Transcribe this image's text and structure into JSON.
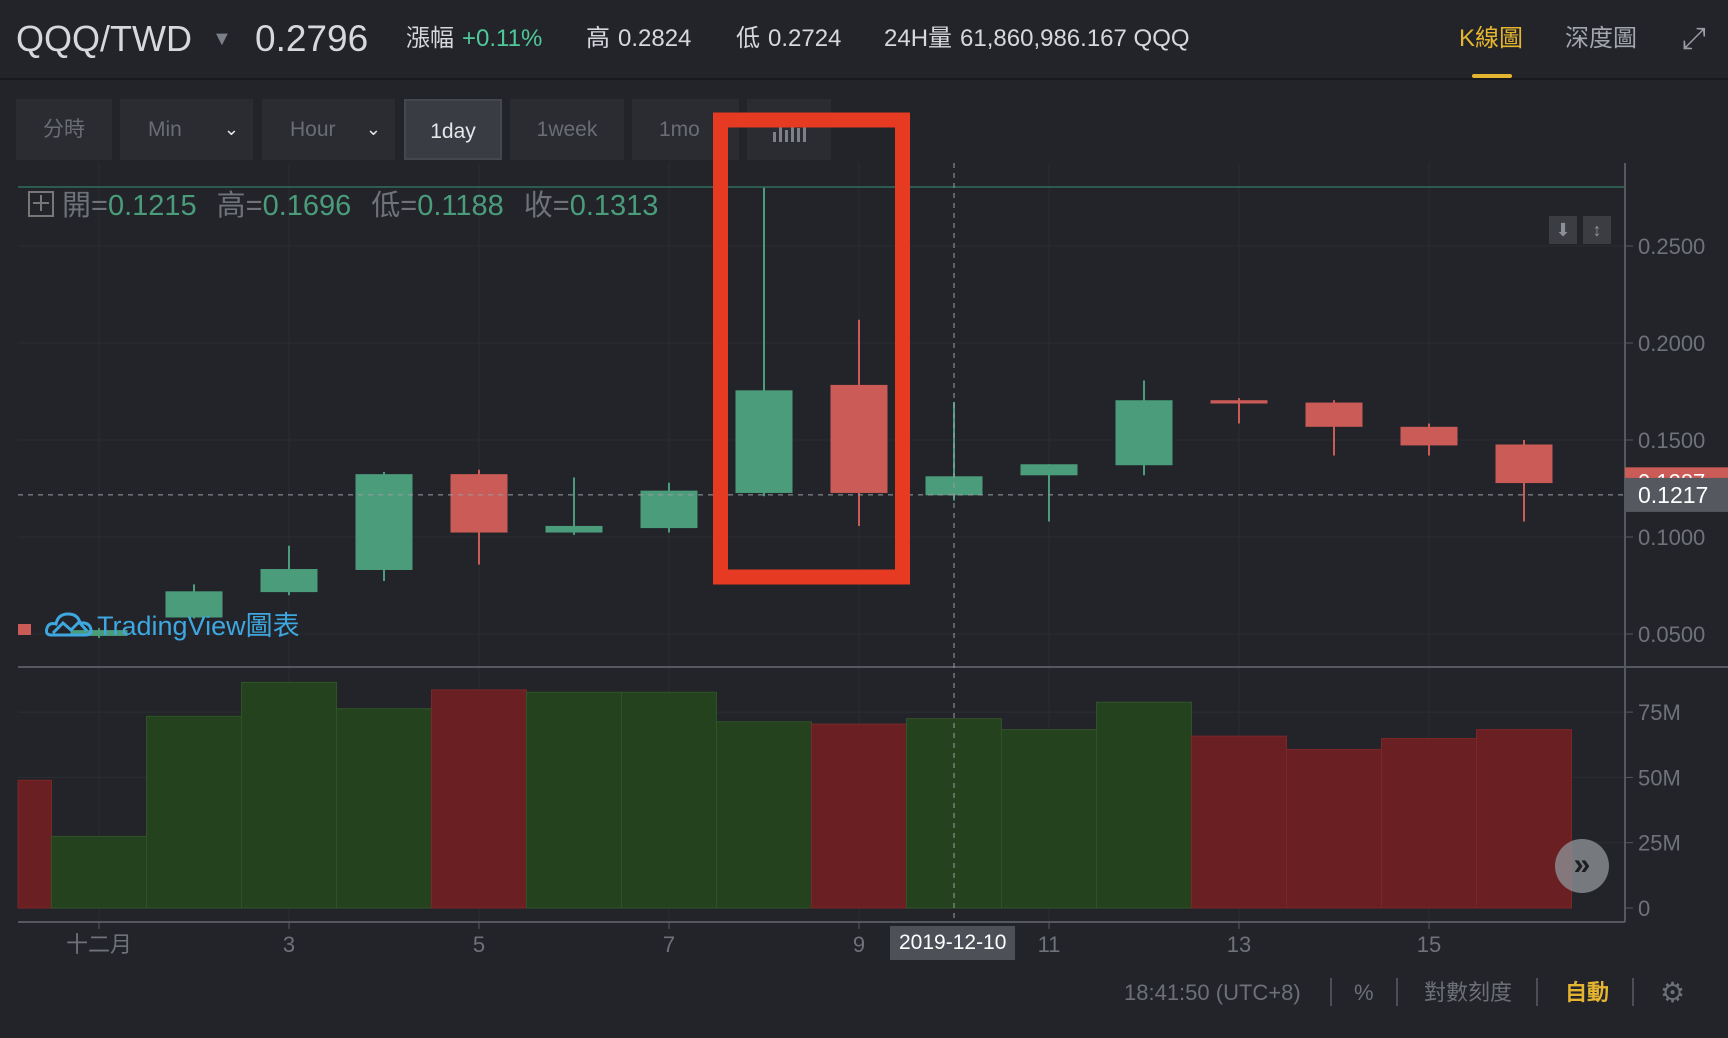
{
  "header": {
    "pair": "QQQ/TWD",
    "price": "0.2796",
    "change_label": "漲幅",
    "change_value": "+0.11%",
    "high_label": "高",
    "high_value": "0.2824",
    "low_label": "低",
    "low_value": "0.2724",
    "volume_label": "24H量",
    "volume_value": "61,860,986.167 QQQ",
    "tabs": [
      {
        "label": "K線圖",
        "active": true
      },
      {
        "label": "深度圖",
        "active": false
      }
    ]
  },
  "toolbar": {
    "items": [
      {
        "label": "分時"
      },
      {
        "label": "Min",
        "dropdown": true
      },
      {
        "label": "Hour",
        "dropdown": true
      },
      {
        "label": "1day",
        "active": true
      },
      {
        "label": "1week"
      },
      {
        "label": "1mo"
      }
    ]
  },
  "legend": {
    "open_label": "開=",
    "open": "0.1215",
    "high_label": "高=",
    "high": "0.1696",
    "low_label": "低=",
    "low": "0.1188",
    "close_label": "收=",
    "close": "0.1313"
  },
  "watermark": "TradingView圖表",
  "colors": {
    "up": "#4a9c7b",
    "down": "#cb5b56",
    "vol_up": "#25421f",
    "vol_down": "#6a1f22",
    "accent": "#e5b431",
    "highlight": "#e63a22"
  },
  "chart_data": {
    "type": "candlestick",
    "x_ticks": [
      "十二月",
      "3",
      "5",
      "7",
      "9",
      "11",
      "13",
      "15"
    ],
    "price_ticks": [
      "0.2500",
      "0.2000",
      "0.1500",
      "0.1000",
      "0.0500"
    ],
    "volume_ticks": [
      "75M",
      "50M",
      "25M",
      "0"
    ],
    "price_range": [
      0.03,
      0.29
    ],
    "crosshair_date": "2019-12-10",
    "crosshair_price": "0.1217",
    "last_price": "0.1287",
    "highlighted_days": [
      8,
      9
    ],
    "candles": [
      {
        "day": 1,
        "o": 0.049,
        "h": 0.053,
        "l": 0.048,
        "c": 0.052
      },
      {
        "day": 2,
        "o": 0.0585,
        "h": 0.0756,
        "l": 0.058,
        "c": 0.072
      },
      {
        "day": 3,
        "o": 0.0716,
        "h": 0.0955,
        "l": 0.07,
        "c": 0.0835
      },
      {
        "day": 4,
        "o": 0.083,
        "h": 0.1335,
        "l": 0.0773,
        "c": 0.1324
      },
      {
        "day": 5,
        "o": 0.1324,
        "h": 0.1347,
        "l": 0.0858,
        "c": 0.1023
      },
      {
        "day": 6,
        "o": 0.1023,
        "h": 0.1307,
        "l": 0.1011,
        "c": 0.1057
      },
      {
        "day": 7,
        "o": 0.1046,
        "h": 0.128,
        "l": 0.1023,
        "c": 0.1239
      },
      {
        "day": 8,
        "o": 0.1227,
        "h": 0.28,
        "l": 0.121,
        "c": 0.1756
      },
      {
        "day": 9,
        "o": 0.1784,
        "h": 0.212,
        "l": 0.1057,
        "c": 0.1227
      },
      {
        "day": 10,
        "o": 0.1215,
        "h": 0.1696,
        "l": 0.1188,
        "c": 0.1313
      },
      {
        "day": 11,
        "o": 0.1318,
        "h": 0.1375,
        "l": 0.108,
        "c": 0.1375
      },
      {
        "day": 12,
        "o": 0.137,
        "h": 0.1807,
        "l": 0.1318,
        "c": 0.1705
      },
      {
        "day": 13,
        "o": 0.1705,
        "h": 0.1716,
        "l": 0.1585,
        "c": 0.1688
      },
      {
        "day": 14,
        "o": 0.1693,
        "h": 0.1705,
        "l": 0.142,
        "c": 0.1568
      },
      {
        "day": 15,
        "o": 0.1568,
        "h": 0.1585,
        "l": 0.142,
        "c": 0.1472
      },
      {
        "day": 16,
        "o": 0.1477,
        "h": 0.15,
        "l": 0.108,
        "c": 0.1278
      }
    ],
    "volume_M": [
      {
        "day": 0,
        "v": 48.9,
        "up": false
      },
      {
        "day": 1,
        "v": 27.4,
        "up": true
      },
      {
        "day": 2,
        "v": 73.4,
        "up": true
      },
      {
        "day": 3,
        "v": 86.4,
        "up": true
      },
      {
        "day": 4,
        "v": 76.3,
        "up": true
      },
      {
        "day": 5,
        "v": 83.5,
        "up": false
      },
      {
        "day": 6,
        "v": 82.6,
        "up": true
      },
      {
        "day": 7,
        "v": 82.6,
        "up": true
      },
      {
        "day": 8,
        "v": 71.3,
        "up": true
      },
      {
        "day": 9,
        "v": 70.4,
        "up": false
      },
      {
        "day": 10,
        "v": 72.5,
        "up": true
      },
      {
        "day": 11,
        "v": 68.3,
        "up": true
      },
      {
        "day": 12,
        "v": 78.8,
        "up": true
      },
      {
        "day": 13,
        "v": 65.8,
        "up": false
      },
      {
        "day": 14,
        "v": 60.7,
        "up": false
      },
      {
        "day": 15,
        "v": 64.9,
        "up": false
      },
      {
        "day": 16,
        "v": 68.3,
        "up": false
      }
    ]
  },
  "footer": {
    "time": "18:41:50 (UTC+8)",
    "percent": "%",
    "log_scale": "對數刻度",
    "auto": "自動"
  }
}
